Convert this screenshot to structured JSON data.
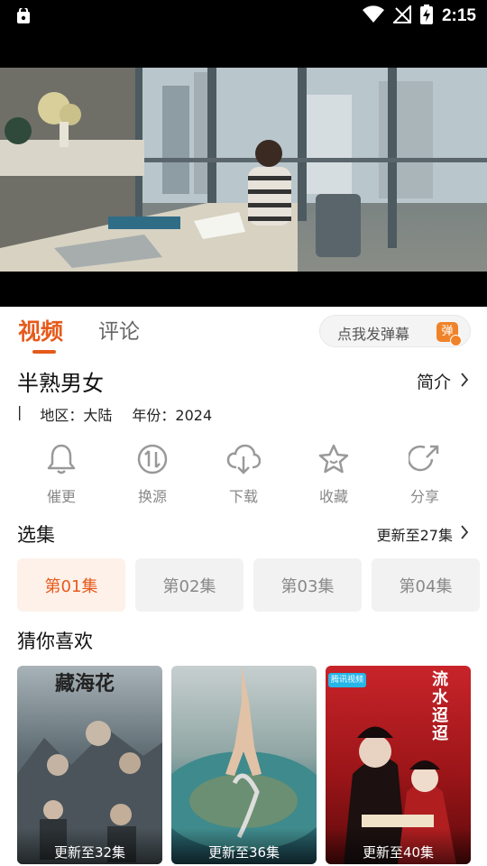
{
  "status_bar": {
    "time": "2:15"
  },
  "tabs": {
    "video": "视频",
    "comment": "评论"
  },
  "danmu": {
    "label": "点我发弹幕",
    "icon_text": "弹"
  },
  "show": {
    "title": "半熟男女",
    "intro_label": "简介",
    "region": "地区：大陆",
    "year": "年份：2024"
  },
  "actions": [
    {
      "label": "催更",
      "icon": "bell-icon"
    },
    {
      "label": "换源",
      "icon": "switch-source-icon"
    },
    {
      "label": "下载",
      "icon": "cloud-download-icon"
    },
    {
      "label": "收藏",
      "icon": "star-icon"
    },
    {
      "label": "分享",
      "icon": "share-icon"
    }
  ],
  "episodes": {
    "section_title": "选集",
    "update_label": "更新至27集",
    "items": [
      "第01集",
      "第02集",
      "第03集",
      "第04集"
    ],
    "active_index": 0
  },
  "recommend": {
    "section_title": "猜你喜欢",
    "items": [
      {
        "caption": "更新至32集",
        "poster_title": "藏海花"
      },
      {
        "caption": "更新至36集",
        "poster_title": ""
      },
      {
        "caption": "更新至40集",
        "poster_title": "流水迢迢",
        "badge": "腾讯视频"
      }
    ]
  },
  "colors": {
    "accent": "#e55a1b",
    "danmu_icon": "#f0832a"
  }
}
